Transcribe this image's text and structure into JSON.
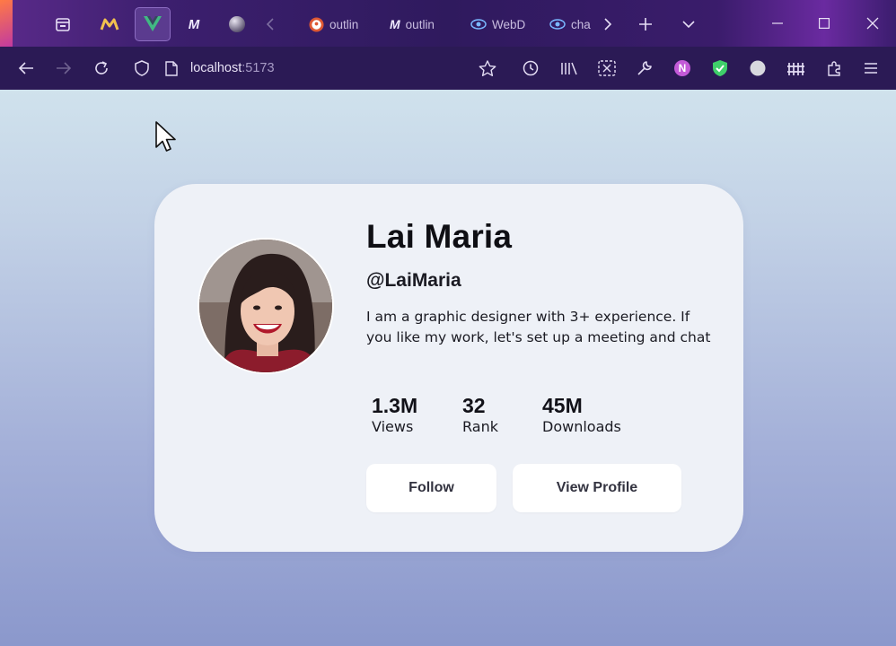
{
  "browser": {
    "tabs": [
      {
        "label": "outlin",
        "icon": "duckduckgo-icon"
      },
      {
        "label": "outlin",
        "icon": "m-logo-icon"
      },
      {
        "label": "WebD",
        "icon": "eye-icon"
      },
      {
        "label": "cha",
        "icon": "eye-icon"
      }
    ],
    "url_host": "localhost",
    "url_port": ":5173"
  },
  "profile": {
    "name": "Lai Maria",
    "handle": "@LaiMaria",
    "bio": "I am a graphic designer with 3+ experience. If you like my work, let's set up a meeting and chat",
    "stats": [
      {
        "value": "1.3M",
        "label": "Views"
      },
      {
        "value": "32",
        "label": "Rank"
      },
      {
        "value": "45M",
        "label": "Downloads"
      }
    ],
    "follow_label": "Follow",
    "view_profile_label": "View Profile"
  },
  "colors": {
    "tabbar": "#2f1a5e",
    "navbar": "#2b1a55",
    "card": "#eef1f7",
    "page_top": "#d9edf1",
    "page_bottom": "#8b98cc"
  }
}
